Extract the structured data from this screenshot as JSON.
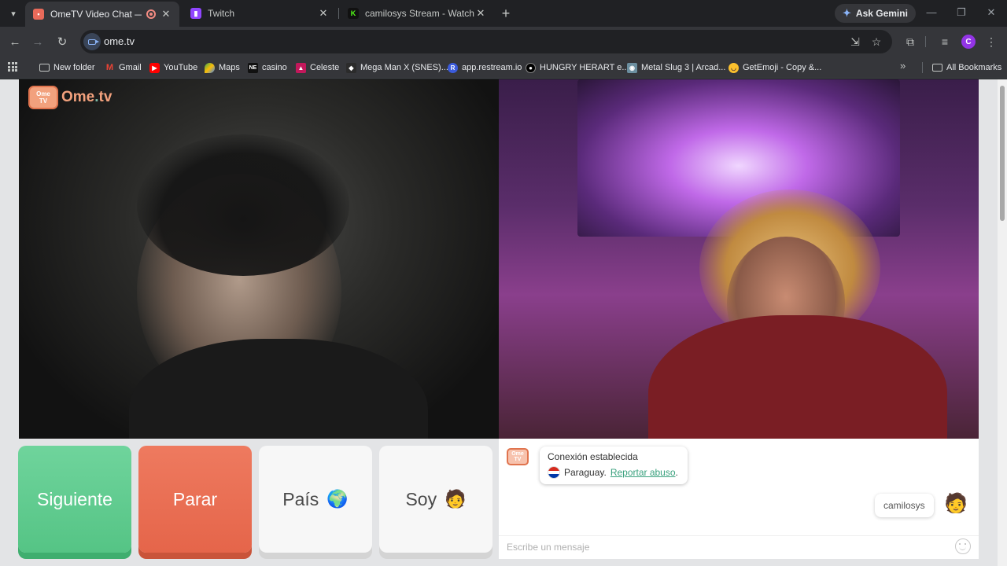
{
  "browser": {
    "tabs": [
      {
        "title": "OmeTV Video Chat — Ome",
        "active": true,
        "favicon": "ometv-favicon",
        "recording": true
      },
      {
        "title": "Twitch",
        "active": false,
        "favicon": "twitch-favicon"
      },
      {
        "title": "camilosys Stream - Watch Live",
        "active": false,
        "favicon": "kick-favicon"
      }
    ],
    "gemini_label": "Ask Gemini",
    "url": "ome.tv",
    "profile_initial": "C",
    "bookmarks": [
      {
        "label": "New folder",
        "icon": "folder-icon"
      },
      {
        "label": "Gmail",
        "icon": "gmail-icon"
      },
      {
        "label": "YouTube",
        "icon": "youtube-icon"
      },
      {
        "label": "Maps",
        "icon": "maps-icon"
      },
      {
        "label": "casino",
        "icon": "ne-icon"
      },
      {
        "label": "Celeste",
        "icon": "celeste-icon"
      },
      {
        "label": "Mega Man X (SNES)...",
        "icon": "megaman-icon"
      },
      {
        "label": "app.restream.io",
        "icon": "restream-icon"
      },
      {
        "label": "HUNGRY HERART e...",
        "icon": "hungry-icon"
      },
      {
        "label": "Metal Slug 3 | Arcad...",
        "icon": "metalslug-icon"
      },
      {
        "label": "GetEmoji - Copy &...",
        "icon": "emoji-icon"
      }
    ],
    "all_bookmarks": "All Bookmarks"
  },
  "page": {
    "logo": {
      "badge_top": "Ome",
      "badge_bottom": "TV",
      "text": "Ome",
      "text_dot": ".",
      "text_tail": "tv"
    },
    "buttons": {
      "next": "Siguiente",
      "stop": "Parar",
      "country": "País",
      "country_emoji": "🌍",
      "me": "Soy",
      "me_emoji": "🧑"
    },
    "chat": {
      "system_status": "Conexión establecida",
      "country": "Paraguay.",
      "report": "Reportar abuso",
      "report_suffix": ".",
      "user_message": "camilosys",
      "user_avatar": "🧑",
      "input_placeholder": "Escribe un mensaje"
    },
    "colors": {
      "next": "#5fcc8f",
      "stop": "#ea6f53",
      "accent": "#3aa17e"
    }
  }
}
